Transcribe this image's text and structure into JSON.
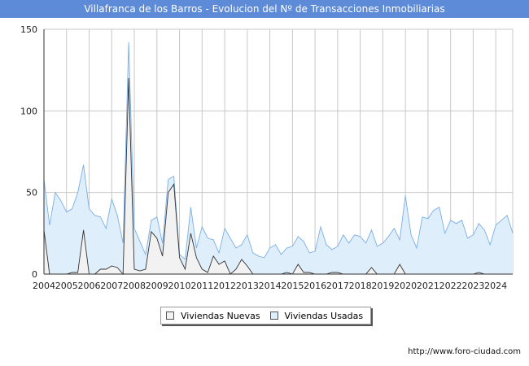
{
  "header": {
    "title": "Villafranca de los Barros - Evolucion del Nº de Transacciones Inmobiliarias"
  },
  "footer": {
    "url": "http://www.foro-ciudad.com"
  },
  "legend": {
    "nuevas_label": "Viviendas Nuevas",
    "usadas_label": "Viviendas Usadas"
  },
  "colors": {
    "title_bg": "#5d8bd8",
    "nuevas_fill": "#f2f2f2",
    "nuevas_line": "#333333",
    "usadas_fill": "#dfeefb",
    "usadas_line": "#7aaee8",
    "grid": "#c8c8c8"
  },
  "chart_data": {
    "type": "area",
    "title": "Villafranca de los Barros - Evolucion del Nº de Transacciones Inmobiliarias",
    "xlabel": "",
    "ylabel": "",
    "ylim": [
      0,
      150
    ],
    "yticks": [
      0,
      50,
      100,
      150
    ],
    "xlim": [
      2004,
      2024.75
    ],
    "xticks": [
      2004,
      2005,
      2006,
      2007,
      2008,
      2009,
      2010,
      2011,
      2012,
      2013,
      2014,
      2015,
      2016,
      2017,
      2018,
      2019,
      2020,
      2021,
      2022,
      2023,
      2024
    ],
    "grid": true,
    "legend_position": "bottom",
    "series": [
      {
        "name": "Viviendas Usadas",
        "points": [
          [
            2004,
            58
          ],
          [
            2004.25,
            30
          ],
          [
            2004.5,
            50
          ],
          [
            2004.75,
            45
          ],
          [
            2005,
            38
          ],
          [
            2005.25,
            40
          ],
          [
            2005.5,
            50
          ],
          [
            2005.75,
            67
          ],
          [
            2006,
            40
          ],
          [
            2006.25,
            36
          ],
          [
            2006.5,
            35
          ],
          [
            2006.75,
            28
          ],
          [
            2007,
            46
          ],
          [
            2007.25,
            36
          ],
          [
            2007.5,
            19
          ],
          [
            2007.75,
            142
          ],
          [
            2008,
            28
          ],
          [
            2008.25,
            20
          ],
          [
            2008.5,
            12
          ],
          [
            2008.75,
            33
          ],
          [
            2009,
            35
          ],
          [
            2009.25,
            19
          ],
          [
            2009.5,
            58
          ],
          [
            2009.75,
            60
          ],
          [
            2010,
            12
          ],
          [
            2010.25,
            9
          ],
          [
            2010.5,
            41
          ],
          [
            2010.75,
            16
          ],
          [
            2011,
            29
          ],
          [
            2011.25,
            22
          ],
          [
            2011.5,
            21
          ],
          [
            2011.75,
            13
          ],
          [
            2012,
            28
          ],
          [
            2012.25,
            22
          ],
          [
            2012.5,
            16
          ],
          [
            2012.75,
            18
          ],
          [
            2013,
            24
          ],
          [
            2013.25,
            13
          ],
          [
            2013.5,
            11
          ],
          [
            2013.75,
            10
          ],
          [
            2014,
            16
          ],
          [
            2014.25,
            18
          ],
          [
            2014.5,
            12
          ],
          [
            2014.75,
            16
          ],
          [
            2015,
            17
          ],
          [
            2015.25,
            23
          ],
          [
            2015.5,
            20
          ],
          [
            2015.75,
            13
          ],
          [
            2016,
            14
          ],
          [
            2016.25,
            29
          ],
          [
            2016.5,
            18
          ],
          [
            2016.75,
            15
          ],
          [
            2017,
            17
          ],
          [
            2017.25,
            24
          ],
          [
            2017.5,
            19
          ],
          [
            2017.75,
            24
          ],
          [
            2018,
            23
          ],
          [
            2018.25,
            19
          ],
          [
            2018.5,
            27
          ],
          [
            2018.75,
            17
          ],
          [
            2019,
            19
          ],
          [
            2019.25,
            23
          ],
          [
            2019.5,
            28
          ],
          [
            2019.75,
            21
          ],
          [
            2020,
            48
          ],
          [
            2020.25,
            24
          ],
          [
            2020.5,
            16
          ],
          [
            2020.75,
            35
          ],
          [
            2021,
            34
          ],
          [
            2021.25,
            39
          ],
          [
            2021.5,
            41
          ],
          [
            2021.75,
            25
          ],
          [
            2022,
            33
          ],
          [
            2022.25,
            31
          ],
          [
            2022.5,
            33
          ],
          [
            2022.75,
            22
          ],
          [
            2023,
            24
          ],
          [
            2023.25,
            31
          ],
          [
            2023.5,
            27
          ],
          [
            2023.75,
            18
          ],
          [
            2024,
            30
          ],
          [
            2024.25,
            33
          ],
          [
            2024.5,
            36
          ],
          [
            2024.75,
            25
          ]
        ]
      },
      {
        "name": "Viviendas Nuevas",
        "points": [
          [
            2004,
            27
          ],
          [
            2004.25,
            0
          ],
          [
            2004.5,
            0
          ],
          [
            2004.75,
            0
          ],
          [
            2005,
            0
          ],
          [
            2005.25,
            1
          ],
          [
            2005.5,
            1
          ],
          [
            2005.75,
            27
          ],
          [
            2006,
            0
          ],
          [
            2006.25,
            0
          ],
          [
            2006.5,
            3
          ],
          [
            2006.75,
            3
          ],
          [
            2007,
            5
          ],
          [
            2007.25,
            4
          ],
          [
            2007.5,
            0
          ],
          [
            2007.75,
            120
          ],
          [
            2008,
            3
          ],
          [
            2008.25,
            2
          ],
          [
            2008.5,
            3
          ],
          [
            2008.75,
            26
          ],
          [
            2009,
            22
          ],
          [
            2009.25,
            11
          ],
          [
            2009.5,
            50
          ],
          [
            2009.75,
            55
          ],
          [
            2010,
            10
          ],
          [
            2010.25,
            3
          ],
          [
            2010.5,
            25
          ],
          [
            2010.75,
            10
          ],
          [
            2011,
            3
          ],
          [
            2011.25,
            1
          ],
          [
            2011.5,
            11
          ],
          [
            2011.75,
            6
          ],
          [
            2012,
            8
          ],
          [
            2012.25,
            0
          ],
          [
            2012.5,
            3
          ],
          [
            2012.75,
            9
          ],
          [
            2013,
            5
          ],
          [
            2013.25,
            0
          ],
          [
            2013.5,
            0
          ],
          [
            2013.75,
            0
          ],
          [
            2014,
            0
          ],
          [
            2014.25,
            0
          ],
          [
            2014.5,
            0
          ],
          [
            2014.75,
            1
          ],
          [
            2015,
            0
          ],
          [
            2015.25,
            6
          ],
          [
            2015.5,
            1
          ],
          [
            2015.75,
            1
          ],
          [
            2016,
            0
          ],
          [
            2016.25,
            0
          ],
          [
            2016.5,
            0
          ],
          [
            2016.75,
            1
          ],
          [
            2017,
            1
          ],
          [
            2017.25,
            0
          ],
          [
            2017.5,
            0
          ],
          [
            2017.75,
            0
          ],
          [
            2018,
            0
          ],
          [
            2018.25,
            0
          ],
          [
            2018.5,
            4
          ],
          [
            2018.75,
            0
          ],
          [
            2019,
            0
          ],
          [
            2019.25,
            0
          ],
          [
            2019.5,
            0
          ],
          [
            2019.75,
            6
          ],
          [
            2020,
            0
          ],
          [
            2020.25,
            0
          ],
          [
            2020.5,
            0
          ],
          [
            2020.75,
            0
          ],
          [
            2021,
            0
          ],
          [
            2021.25,
            0
          ],
          [
            2021.5,
            0
          ],
          [
            2021.75,
            0
          ],
          [
            2022,
            0
          ],
          [
            2022.25,
            0
          ],
          [
            2022.5,
            0
          ],
          [
            2022.75,
            0
          ],
          [
            2023,
            0
          ],
          [
            2023.25,
            1
          ],
          [
            2023.5,
            0
          ],
          [
            2023.75,
            0
          ],
          [
            2024,
            0
          ],
          [
            2024.25,
            0
          ],
          [
            2024.5,
            0
          ],
          [
            2024.75,
            0
          ]
        ]
      }
    ]
  }
}
